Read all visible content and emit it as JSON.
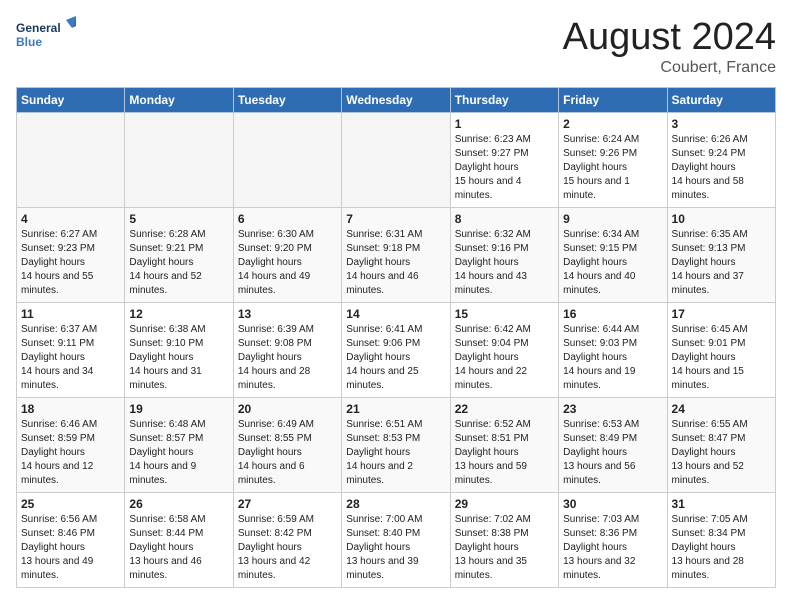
{
  "header": {
    "logo_general": "General",
    "logo_blue": "Blue",
    "month_year": "August 2024",
    "location": "Coubert, France"
  },
  "weekdays": [
    "Sunday",
    "Monday",
    "Tuesday",
    "Wednesday",
    "Thursday",
    "Friday",
    "Saturday"
  ],
  "weeks": [
    [
      {
        "day": "",
        "empty": true
      },
      {
        "day": "",
        "empty": true
      },
      {
        "day": "",
        "empty": true
      },
      {
        "day": "",
        "empty": true
      },
      {
        "day": "1",
        "sunrise": "6:23 AM",
        "sunset": "9:27 PM",
        "daylight": "15 hours and 4 minutes."
      },
      {
        "day": "2",
        "sunrise": "6:24 AM",
        "sunset": "9:26 PM",
        "daylight": "15 hours and 1 minute."
      },
      {
        "day": "3",
        "sunrise": "6:26 AM",
        "sunset": "9:24 PM",
        "daylight": "14 hours and 58 minutes."
      }
    ],
    [
      {
        "day": "4",
        "sunrise": "6:27 AM",
        "sunset": "9:23 PM",
        "daylight": "14 hours and 55 minutes."
      },
      {
        "day": "5",
        "sunrise": "6:28 AM",
        "sunset": "9:21 PM",
        "daylight": "14 hours and 52 minutes."
      },
      {
        "day": "6",
        "sunrise": "6:30 AM",
        "sunset": "9:20 PM",
        "daylight": "14 hours and 49 minutes."
      },
      {
        "day": "7",
        "sunrise": "6:31 AM",
        "sunset": "9:18 PM",
        "daylight": "14 hours and 46 minutes."
      },
      {
        "day": "8",
        "sunrise": "6:32 AM",
        "sunset": "9:16 PM",
        "daylight": "14 hours and 43 minutes."
      },
      {
        "day": "9",
        "sunrise": "6:34 AM",
        "sunset": "9:15 PM",
        "daylight": "14 hours and 40 minutes."
      },
      {
        "day": "10",
        "sunrise": "6:35 AM",
        "sunset": "9:13 PM",
        "daylight": "14 hours and 37 minutes."
      }
    ],
    [
      {
        "day": "11",
        "sunrise": "6:37 AM",
        "sunset": "9:11 PM",
        "daylight": "14 hours and 34 minutes."
      },
      {
        "day": "12",
        "sunrise": "6:38 AM",
        "sunset": "9:10 PM",
        "daylight": "14 hours and 31 minutes."
      },
      {
        "day": "13",
        "sunrise": "6:39 AM",
        "sunset": "9:08 PM",
        "daylight": "14 hours and 28 minutes."
      },
      {
        "day": "14",
        "sunrise": "6:41 AM",
        "sunset": "9:06 PM",
        "daylight": "14 hours and 25 minutes."
      },
      {
        "day": "15",
        "sunrise": "6:42 AM",
        "sunset": "9:04 PM",
        "daylight": "14 hours and 22 minutes."
      },
      {
        "day": "16",
        "sunrise": "6:44 AM",
        "sunset": "9:03 PM",
        "daylight": "14 hours and 19 minutes."
      },
      {
        "day": "17",
        "sunrise": "6:45 AM",
        "sunset": "9:01 PM",
        "daylight": "14 hours and 15 minutes."
      }
    ],
    [
      {
        "day": "18",
        "sunrise": "6:46 AM",
        "sunset": "8:59 PM",
        "daylight": "14 hours and 12 minutes."
      },
      {
        "day": "19",
        "sunrise": "6:48 AM",
        "sunset": "8:57 PM",
        "daylight": "14 hours and 9 minutes."
      },
      {
        "day": "20",
        "sunrise": "6:49 AM",
        "sunset": "8:55 PM",
        "daylight": "14 hours and 6 minutes."
      },
      {
        "day": "21",
        "sunrise": "6:51 AM",
        "sunset": "8:53 PM",
        "daylight": "14 hours and 2 minutes."
      },
      {
        "day": "22",
        "sunrise": "6:52 AM",
        "sunset": "8:51 PM",
        "daylight": "13 hours and 59 minutes."
      },
      {
        "day": "23",
        "sunrise": "6:53 AM",
        "sunset": "8:49 PM",
        "daylight": "13 hours and 56 minutes."
      },
      {
        "day": "24",
        "sunrise": "6:55 AM",
        "sunset": "8:47 PM",
        "daylight": "13 hours and 52 minutes."
      }
    ],
    [
      {
        "day": "25",
        "sunrise": "6:56 AM",
        "sunset": "8:46 PM",
        "daylight": "13 hours and 49 minutes."
      },
      {
        "day": "26",
        "sunrise": "6:58 AM",
        "sunset": "8:44 PM",
        "daylight": "13 hours and 46 minutes."
      },
      {
        "day": "27",
        "sunrise": "6:59 AM",
        "sunset": "8:42 PM",
        "daylight": "13 hours and 42 minutes."
      },
      {
        "day": "28",
        "sunrise": "7:00 AM",
        "sunset": "8:40 PM",
        "daylight": "13 hours and 39 minutes."
      },
      {
        "day": "29",
        "sunrise": "7:02 AM",
        "sunset": "8:38 PM",
        "daylight": "13 hours and 35 minutes."
      },
      {
        "day": "30",
        "sunrise": "7:03 AM",
        "sunset": "8:36 PM",
        "daylight": "13 hours and 32 minutes."
      },
      {
        "day": "31",
        "sunrise": "7:05 AM",
        "sunset": "8:34 PM",
        "daylight": "13 hours and 28 minutes."
      }
    ]
  ],
  "labels": {
    "sunrise": "Sunrise:",
    "sunset": "Sunset:",
    "daylight": "Daylight hours"
  }
}
